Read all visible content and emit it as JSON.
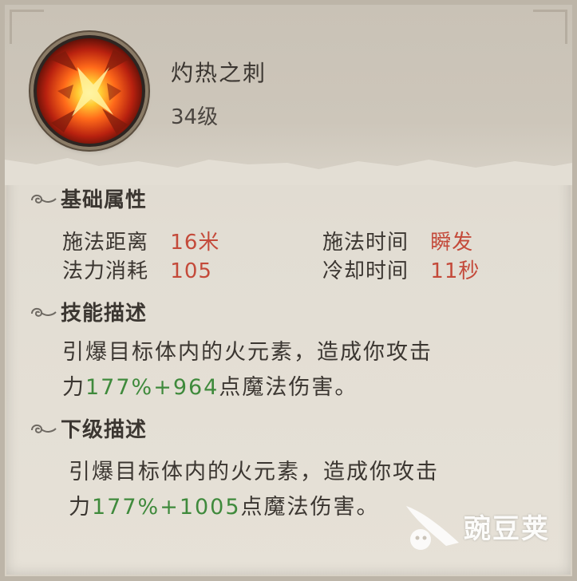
{
  "skill": {
    "name": "灼热之刺",
    "level": "34级",
    "icon": "fire-explosion-icon"
  },
  "basic": {
    "title": "基础属性",
    "attributes": [
      {
        "label": "施法距离",
        "value": "16米"
      },
      {
        "label": "施法时间",
        "value": "瞬发"
      },
      {
        "label": "法力消耗",
        "value": "105"
      },
      {
        "label": "冷却时间",
        "value": "11秒"
      }
    ]
  },
  "skill_desc": {
    "title": "技能描述",
    "line1": "引爆目标体内的火元素，造成你攻击",
    "pre": "力",
    "hl1": "177%+964",
    "post": "点魔法伤害。"
  },
  "next_desc": {
    "title": "下级描述",
    "line1": "引爆目标体内的火元素，造成你攻击",
    "pre": "力",
    "hl1": "177%+1005",
    "post": "点魔法伤害。"
  },
  "watermark": {
    "text": "豌豆荚"
  },
  "colors": {
    "value_red": "#c44a3a",
    "value_green": "#3f8a3c",
    "text_dark": "#3b3631"
  }
}
